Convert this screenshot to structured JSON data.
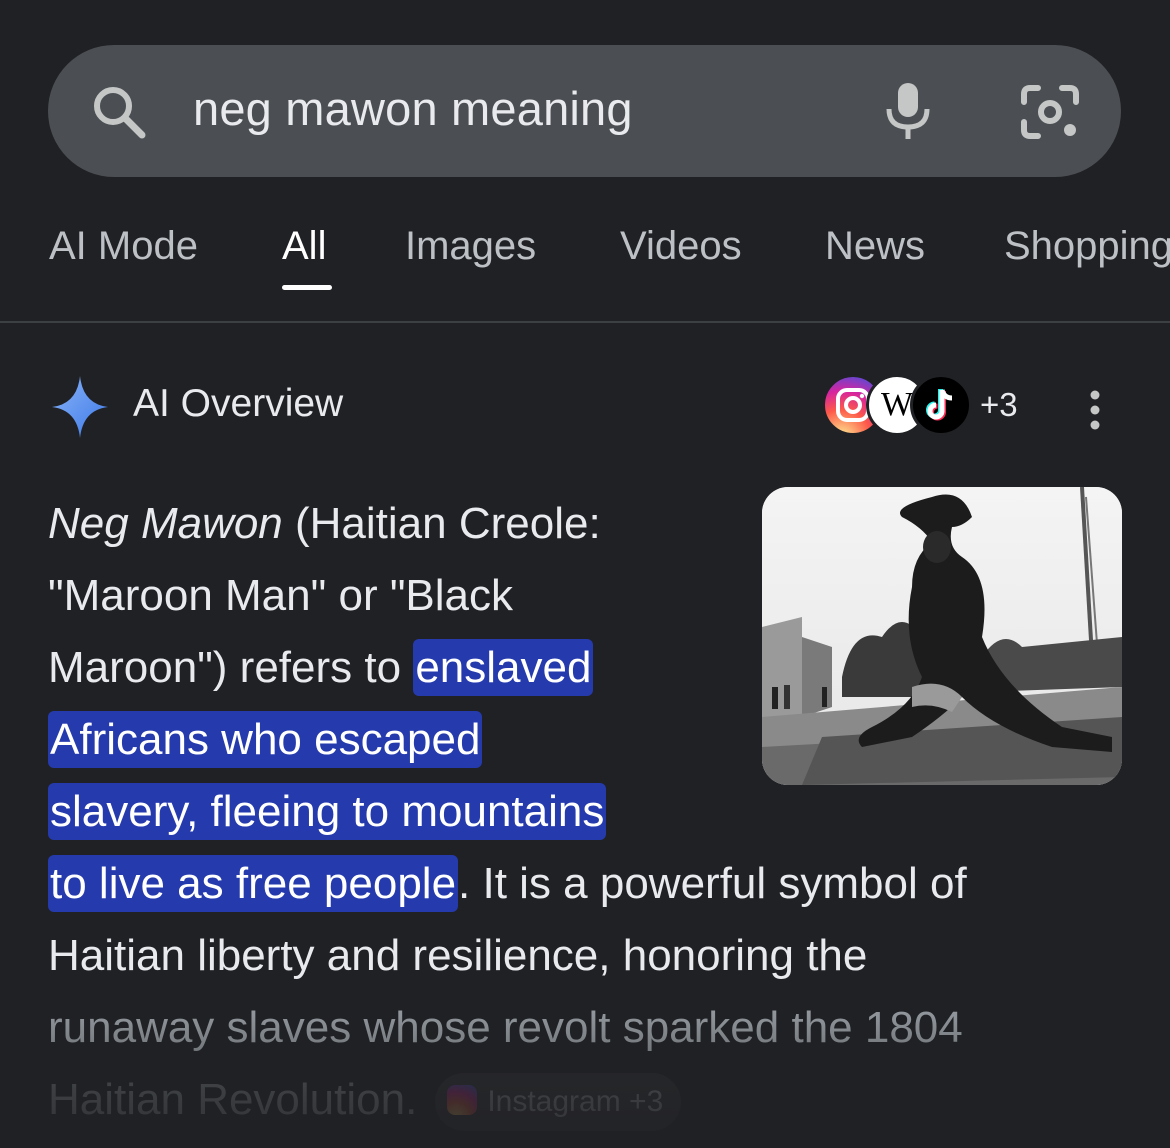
{
  "search": {
    "query": "neg mawon meaning",
    "search_icon": "search-icon",
    "mic_icon": "microphone-icon",
    "lens_icon": "camera-lens-icon"
  },
  "tabs": [
    {
      "label": "AI Mode",
      "active": false
    },
    {
      "label": "All",
      "active": true
    },
    {
      "label": "Images",
      "active": false
    },
    {
      "label": "Videos",
      "active": false
    },
    {
      "label": "News",
      "active": false
    },
    {
      "label": "Shopping",
      "active": false
    }
  ],
  "ai_overview": {
    "title": "AI Overview",
    "sparkle_icon": "sparkle-icon",
    "sources": [
      "instagram-icon",
      "wikipedia-icon",
      "tiktok-icon"
    ],
    "wiki_letter": "W",
    "more_sources": "+3",
    "menu_icon": "more-vert-icon",
    "lines": {
      "l1_italic": "Neg Mawon",
      "l1_rest": " (Haitian Creole:",
      "l2": "\"Maroon Man\" or \"Black",
      "l3_plain": "Maroon\") refers to ",
      "l3_hl": "enslaved",
      "l4_hl": "Africans who escaped",
      "l5_hl": "slavery, fleeing to mountains",
      "l6_hl": "to live as free people",
      "l6_rest": ". It is a powerful symbol of",
      "l7": "Haitian liberty and resilience, honoring the",
      "l8": "runaway slaves whose revolt sparked the 1804",
      "l9": "Haitian Revolution."
    },
    "chip_label": "Instagram +3",
    "image_alt": "Neg Mawon statue"
  },
  "colors": {
    "background": "#202124",
    "search_bg": "#4b4e53",
    "highlight": "#253aad",
    "sparkle": "#4c8df6"
  }
}
